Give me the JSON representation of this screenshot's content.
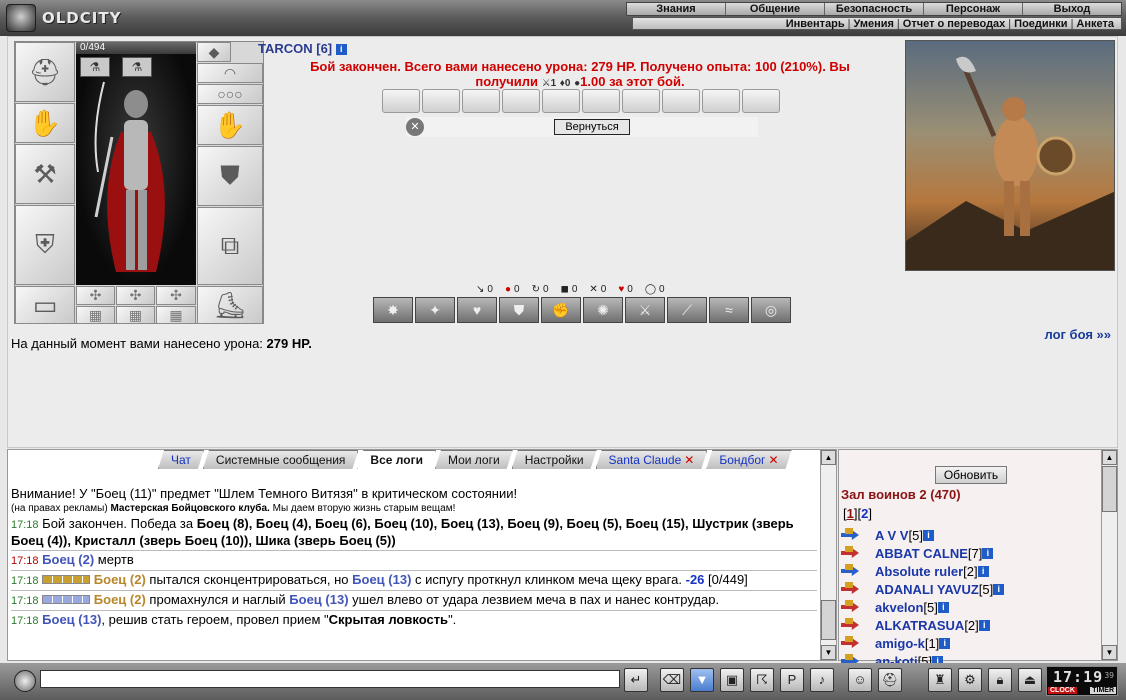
{
  "app": {
    "logo_text": "OLDCITY"
  },
  "menu": {
    "main": [
      "Знания",
      "Общение",
      "Безопасность",
      "Персонаж",
      "Выход"
    ],
    "sub": [
      "Инвентарь",
      "Умения",
      "Отчет о переводах",
      "Поединки",
      "Анкета"
    ]
  },
  "character": {
    "hp_text": "0/494",
    "nick": "TARCON [6]",
    "info_icon": "info-icon"
  },
  "fight": {
    "message_line1": "Бой закончен. Всего вами нанесено урона: 279 HP. Получено опыта: 100 (210%). Вы",
    "message_line2_prefix": "получили",
    "reward1": "1",
    "reward2": "0",
    "reward3": "1.00",
    "message_line2_suffix": "за этот бой.",
    "back_button": "Вернуться",
    "counters": [
      "0",
      "0",
      "0",
      "0",
      "0",
      "0",
      "0"
    ],
    "damage_label": "На данный момент вами нанесено урона:",
    "damage_value": "279 HP.",
    "log_link": "лог боя »»"
  },
  "chat": {
    "tabs": [
      {
        "label": "Чат"
      },
      {
        "label": "Системные сообщения"
      },
      {
        "label": "Все логи"
      },
      {
        "label": "Мои логи"
      },
      {
        "label": "Настройки"
      },
      {
        "label": "Santa Claude"
      },
      {
        "label": "Бондбог"
      }
    ],
    "warning": "Внимание! У \"Боец (11)\" предмет \"Шлем Темного Витязя\" в критическом состоянии!",
    "ad_prefix": "(на правах рекламы)",
    "ad_club": "Мастерская Бойцовского клуба.",
    "ad_suffix": "Мы даем вторую жизнь старым вещам!",
    "l1_time": "17:18",
    "l1_text": "Бой закончен. Победа за",
    "l1_winners": "Боец (8), Боец (4), Боец (6), Боец (10), Боец (13), Боец (9), Боец (5), Боец (15), Шустрик (зверь Боец (4)), Кристалл (зверь Боец (10)), Шика (зверь Боец (5))",
    "l2_time": "17:18",
    "l2_name": "Боец (2)",
    "l2_text": "мертв",
    "l3_time": "17:18",
    "l3_name": "Боец (2)",
    "l3_text1": "пытался сконцентрироваться, но",
    "l3_name2": "Боец (13)",
    "l3_text2": "с испугу проткнул клинком меча щеку врага.",
    "l3_dmg": "-26",
    "l3_hp": "[0/449]",
    "l4_time": "17:18",
    "l4_name": "Боец (2)",
    "l4_text1": "промахнулся и наглый",
    "l4_name2": "Боец (13)",
    "l4_text2": "ушел влево от удара лезвием меча в пах и нанес контрудар.",
    "l5_time": "17:18",
    "l5_name": "Боец (13)",
    "l5_text1": ", решив стать героем, провел прием \"",
    "l5_skill": "Скрытая ловкость",
    "l5_text2": "\"."
  },
  "users": {
    "refresh": "Обновить",
    "title": "Зал воинов 2 (470)",
    "page1": "1",
    "page2": "2",
    "list": [
      {
        "name": "A V V",
        "lvl": "[5]"
      },
      {
        "name": "ABBAT CALNE",
        "lvl": "[7]"
      },
      {
        "name": "Absolute ruler",
        "lvl": "[2]"
      },
      {
        "name": "ADANALI YAVUZ",
        "lvl": "[5]"
      },
      {
        "name": "akvelon",
        "lvl": "[5]"
      },
      {
        "name": "ALKATRASUA",
        "lvl": "[2]"
      },
      {
        "name": "amigo-k",
        "lvl": "[1]"
      },
      {
        "name": "an-koti",
        "lvl": "[5]"
      }
    ]
  },
  "clock": {
    "time": "17:19",
    "seconds": "39",
    "label1": "CLOCK",
    "label2": "TIMER"
  }
}
